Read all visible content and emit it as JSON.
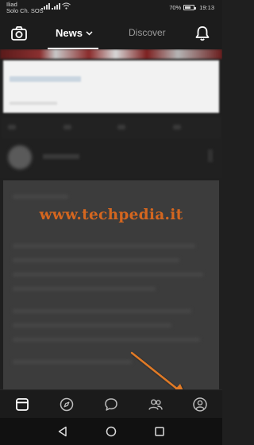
{
  "status_bar": {
    "carrier_line1": "Iliad",
    "carrier_line2": "Solo Ch. SOS",
    "battery_percent": "70%",
    "battery_level": 0.7,
    "time": "19:13"
  },
  "top_bar": {
    "camera_icon": "camera-icon",
    "tab_news": "News",
    "tab_discover": "Discover",
    "notifications_icon": "bell-icon"
  },
  "feed": {
    "watermark": "www.techpedia.it"
  },
  "bottom_nav": {
    "items": [
      {
        "icon": "home-feed-icon",
        "selected": true
      },
      {
        "icon": "compass-icon",
        "selected": false
      },
      {
        "icon": "chat-bubble-icon",
        "selected": false
      },
      {
        "icon": "people-icon",
        "selected": false
      },
      {
        "icon": "profile-icon",
        "selected": false
      }
    ]
  },
  "system_nav": {
    "back_icon": "back-triangle-icon",
    "home_icon": "home-circle-icon",
    "recents_icon": "recents-square-icon"
  },
  "colors": {
    "background": "#1f1f1f",
    "arrow": "#e07a26",
    "watermark": "#d4661f",
    "inactive_tab": "#9a9a9a"
  }
}
